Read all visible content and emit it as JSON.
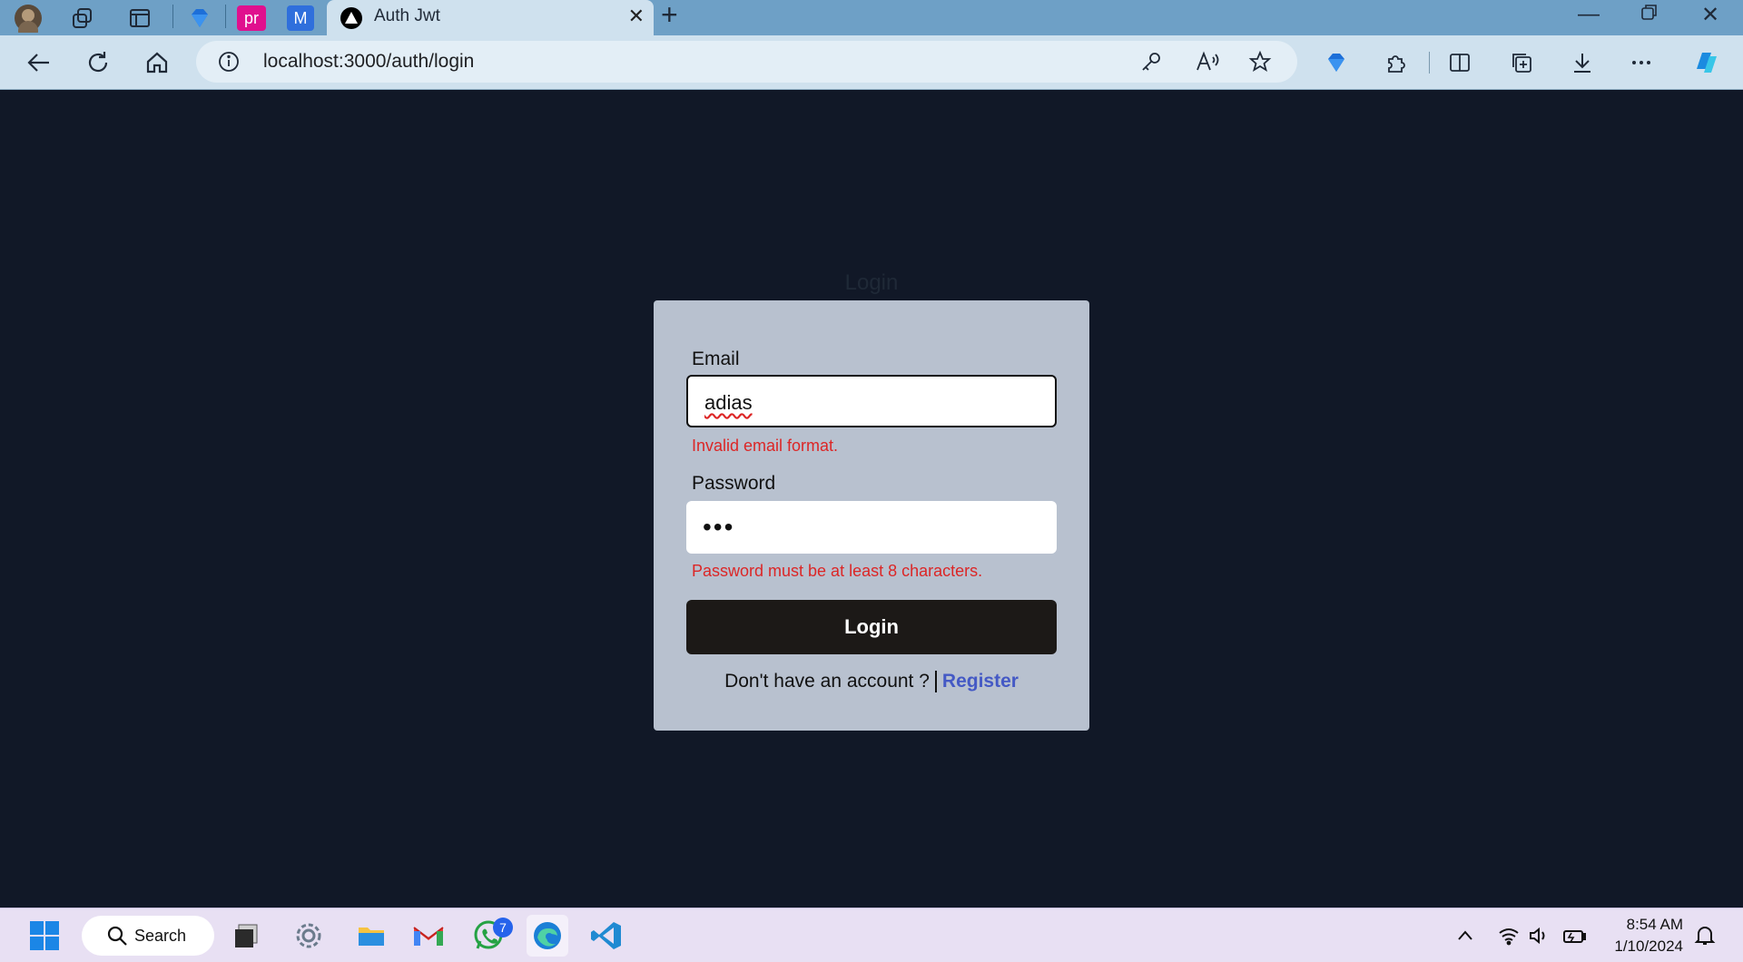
{
  "browser": {
    "active_tab_title": "Auth Jwt",
    "pinned_tabs": [
      {
        "label": "pr",
        "color": "#e0108e"
      },
      {
        "label": "M",
        "color": "#2f6fdc"
      }
    ],
    "url": "localhost:3000/auth/login"
  },
  "page": {
    "heading": "Login",
    "email": {
      "label": "Email",
      "value": "adias",
      "error": "Invalid email format."
    },
    "password": {
      "label": "Password",
      "masked_value": "•••",
      "error": "Password must be at least 8 characters."
    },
    "submit_label": "Login",
    "register_prompt": "Don't have an account ?",
    "register_link": "Register"
  },
  "taskbar": {
    "search_label": "Search",
    "whatsapp_badge": "7",
    "time": "8:54 AM",
    "date": "1/10/2024"
  },
  "colors": {
    "page_bg": "#111827",
    "card_bg": "#b8c1cf",
    "error": "#dc2626",
    "button_bg": "#1c1917",
    "link": "#4459c5"
  }
}
